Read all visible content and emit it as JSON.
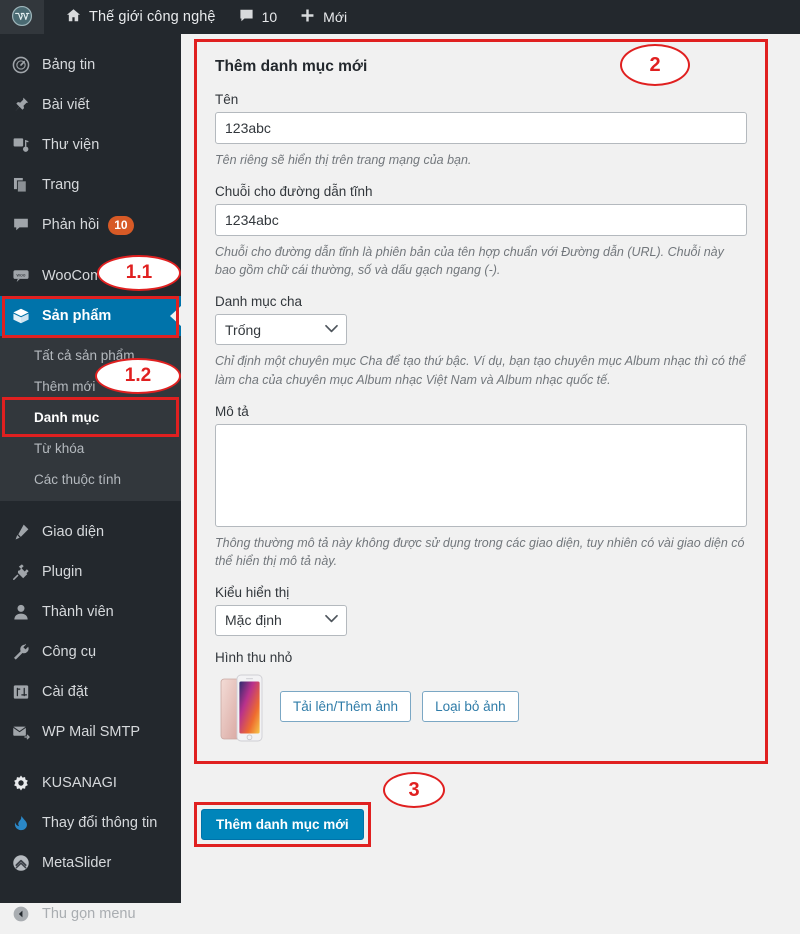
{
  "adminbar": {
    "logo_icon": "wordpress-icon",
    "home_icon": "home-icon",
    "site_name": "Thế giới công nghệ",
    "comments_icon": "comment-icon",
    "comments_count": "10",
    "new_icon": "plus-icon",
    "new_label": "Mới"
  },
  "sidebar": {
    "items": [
      {
        "label": "Bảng tin",
        "icon": "dashboard-icon"
      },
      {
        "label": "Bài viết",
        "icon": "pin-icon"
      },
      {
        "label": "Thư viện",
        "icon": "media-icon"
      },
      {
        "label": "Trang",
        "icon": "pages-icon"
      },
      {
        "label": "Phản hồi",
        "icon": "comment-icon",
        "badge": "10"
      },
      {
        "label": "WooCommerce",
        "icon": "woocommerce-icon"
      },
      {
        "label": "Sản phẩm",
        "icon": "products-box-icon",
        "current": true
      }
    ],
    "submenu": [
      {
        "label": "Tất cả sản phẩm"
      },
      {
        "label": "Thêm mới"
      },
      {
        "label": "Danh mục",
        "current": true
      },
      {
        "label": "Từ khóa"
      },
      {
        "label": "Các thuộc tính"
      }
    ],
    "items_lower": [
      {
        "label": "Giao diện",
        "icon": "appearance-brush-icon"
      },
      {
        "label": "Plugin",
        "icon": "plugin-plug-icon"
      },
      {
        "label": "Thành viên",
        "icon": "user-icon"
      },
      {
        "label": "Công cụ",
        "icon": "wrench-icon"
      },
      {
        "label": "Cài đặt",
        "icon": "settings-sliders-icon"
      },
      {
        "label": "WP Mail SMTP",
        "icon": "mail-icon"
      }
    ],
    "items_plugins": [
      {
        "label": "KUSANAGI",
        "icon": "gear-icon"
      },
      {
        "label": "Thay đổi thông tin",
        "icon": "flame-icon"
      },
      {
        "label": "MetaSlider",
        "icon": "metaslider-chevron-icon"
      }
    ],
    "collapse": {
      "label": "Thu gọn menu",
      "icon": "collapse-arrow-icon"
    }
  },
  "form": {
    "title": "Thêm danh mục mới",
    "name": {
      "label": "Tên",
      "value": "123abc",
      "placeholder": "",
      "help": "Tên riêng sẽ hiển thị trên trang mạng của bạn."
    },
    "slug": {
      "label": "Chuỗi cho đường dẫn tĩnh",
      "value": "1234abc",
      "placeholder": "",
      "help": "Chuỗi cho đường dẫn tĩnh là phiên bản của tên hợp chuẩn với Đường dẫn (URL). Chuỗi này bao gồm chữ cái thường, số và dấu gạch ngang (-)."
    },
    "parent": {
      "label": "Danh mục cha",
      "value": "Trống",
      "options": [
        "Trống"
      ],
      "help": "Chỉ định một chuyên mục Cha để tạo thứ bậc. Ví dụ, bạn tạo chuyên mục Album nhạc thì có thể làm cha của chuyên mục Album nhạc Việt Nam và Album nhạc quốc tế."
    },
    "description": {
      "label": "Mô tả",
      "value": "",
      "placeholder": "",
      "help": "Thông thường mô tả này không được sử dụng trong các giao diện, tuy nhiên có vài giao diện có thể hiển thị mô tả này."
    },
    "display_type": {
      "label": "Kiểu hiển thị",
      "value": "Mặc định",
      "options": [
        "Mặc định"
      ]
    },
    "thumbnail": {
      "label": "Hình thu nhỏ",
      "image_icon": "iphone-thumbnail-image",
      "upload_label": "Tải lên/Thêm ảnh",
      "remove_label": "Loại bỏ ảnh"
    },
    "submit_label": "Thêm danh mục mới"
  },
  "annotations": [
    {
      "id": "1.1",
      "text": "1.1"
    },
    {
      "id": "1.2",
      "text": "1.2"
    },
    {
      "id": "2",
      "text": "2"
    },
    {
      "id": "3",
      "text": "3"
    }
  ],
  "colors": {
    "admin_dark": "#23282d",
    "submenu_dark": "#32373c",
    "current_blue": "#0073aa",
    "primary_button": "#0085ba",
    "annotation_red": "#e02020",
    "badge_orange": "#d75a26",
    "page_bg": "#f1f1f1"
  }
}
